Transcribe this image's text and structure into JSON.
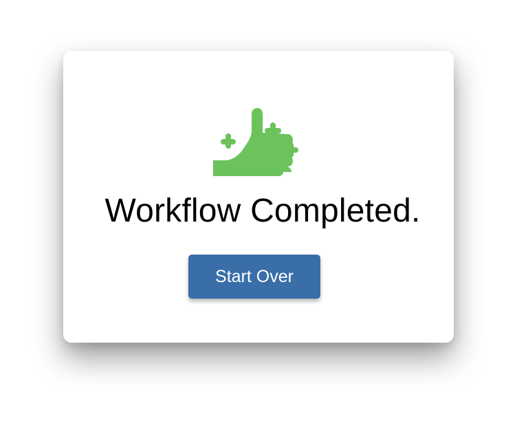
{
  "dialog": {
    "icon": "thumbs-up-sparkle-icon",
    "title": "Workflow Completed.",
    "button_label": "Start Over"
  },
  "colors": {
    "icon": "#6cc35b",
    "button": "#3a6ea8",
    "button_text": "#ffffff",
    "title_text": "#000000"
  }
}
